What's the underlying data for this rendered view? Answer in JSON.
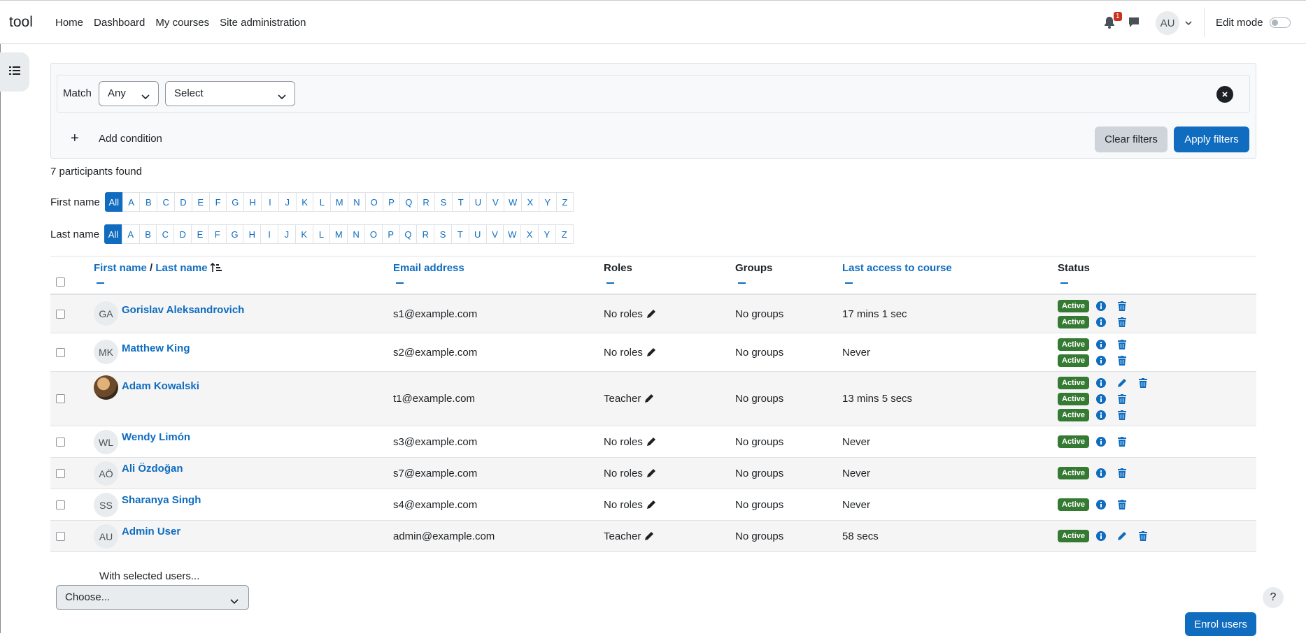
{
  "navbar": {
    "brand": "tool",
    "links": [
      "Home",
      "Dashboard",
      "My courses",
      "Site administration"
    ],
    "notification_count": "1",
    "user_initials": "AU",
    "edit_mode_label": "Edit mode"
  },
  "filters": {
    "match_label": "Match",
    "match_value": "Any",
    "select_value": "Select",
    "add_condition": "Add condition",
    "clear_filters": "Clear filters",
    "apply_filters": "Apply filters"
  },
  "participants_found": "7 participants found",
  "initials_bar": {
    "first_name_label": "First name",
    "last_name_label": "Last name",
    "letters": [
      "All",
      "A",
      "B",
      "C",
      "D",
      "E",
      "F",
      "G",
      "H",
      "I",
      "J",
      "K",
      "L",
      "M",
      "N",
      "O",
      "P",
      "Q",
      "R",
      "S",
      "T",
      "U",
      "V",
      "W",
      "X",
      "Y",
      "Z"
    ]
  },
  "table": {
    "headers": {
      "first_name": "First name",
      "separator": "/",
      "last_name": "Last name",
      "email": "Email address",
      "roles": "Roles",
      "groups": "Groups",
      "last_access": "Last access to course",
      "status": "Status"
    },
    "rows": [
      {
        "initials": "GA",
        "name": "Gorislav Aleksandrovich",
        "email": "s1@example.com",
        "role": "No roles",
        "groups": "No groups",
        "last_access": "17 mins 1 sec",
        "statuses": [
          "Active",
          "Active"
        ]
      },
      {
        "initials": "MK",
        "name": "Matthew King",
        "email": "s2@example.com",
        "role": "No roles",
        "groups": "No groups",
        "last_access": "Never",
        "statuses": [
          "Active",
          "Active"
        ]
      },
      {
        "initials": "",
        "name": "Adam Kowalski",
        "email": "t1@example.com",
        "role": "Teacher",
        "groups": "No groups",
        "last_access": "13 mins 5 secs",
        "statuses": [
          "Active",
          "Active",
          "Active"
        ]
      },
      {
        "initials": "WL",
        "name": "Wendy Limón",
        "email": "s3@example.com",
        "role": "No roles",
        "groups": "No groups",
        "last_access": "Never",
        "statuses": [
          "Active"
        ]
      },
      {
        "initials": "AÖ",
        "name": "Ali Özdoğan",
        "email": "s7@example.com",
        "role": "No roles",
        "groups": "No groups",
        "last_access": "Never",
        "statuses": [
          "Active"
        ]
      },
      {
        "initials": "SS",
        "name": "Sharanya Singh",
        "email": "s4@example.com",
        "role": "No roles",
        "groups": "No groups",
        "last_access": "Never",
        "statuses": [
          "Active"
        ]
      },
      {
        "initials": "AU",
        "name": "Admin User",
        "email": "admin@example.com",
        "role": "Teacher",
        "groups": "No groups",
        "last_access": "58 secs",
        "statuses": [
          "Active"
        ]
      }
    ]
  },
  "bulk": {
    "with_selected": "With selected users...",
    "choose": "Choose..."
  },
  "help_label": "?",
  "enrol_users": "Enrol users",
  "colors": {
    "primary": "#0f6cbf",
    "active_badge": "#357a32",
    "notification": "#ca3120"
  }
}
